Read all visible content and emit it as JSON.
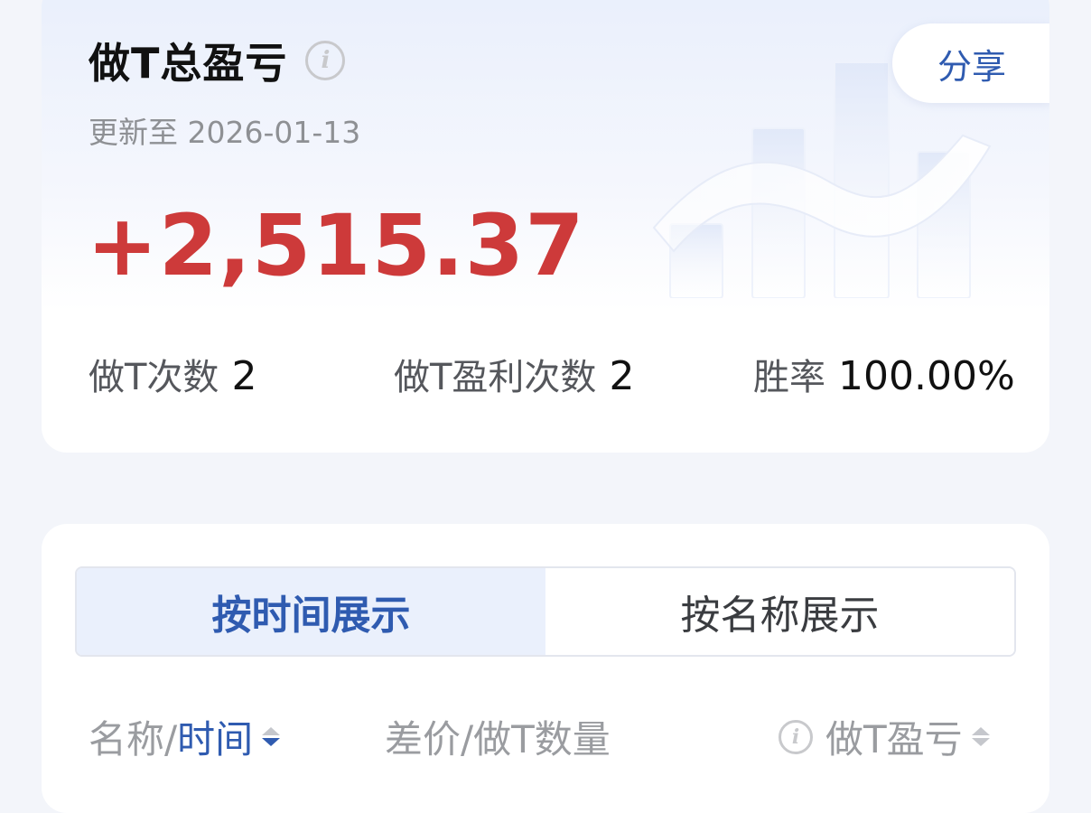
{
  "summary": {
    "title": "做T总盈亏",
    "info_icon": "i",
    "share_label": "分享",
    "updated_text": "更新至 2026-01-13",
    "total_pnl": "+2,515.37",
    "pnl_color": "#cd3a3a",
    "stats": [
      {
        "label": "做T次数",
        "value": "2"
      },
      {
        "label": "做T盈利次数",
        "value": "2"
      },
      {
        "label": "胜率",
        "value": "100.00%"
      }
    ]
  },
  "view_toggle": {
    "options": [
      {
        "label": "按时间展示",
        "active": true
      },
      {
        "label": "按名称展示",
        "active": false
      }
    ]
  },
  "table_header": {
    "name_label": "名称/",
    "time_label": "时间",
    "price_qty_label": "差价/做T数量",
    "info_icon": "i",
    "pnl_label": "做T盈亏"
  },
  "colors": {
    "accent": "#2f5bb0",
    "profit": "#cd3a3a"
  }
}
